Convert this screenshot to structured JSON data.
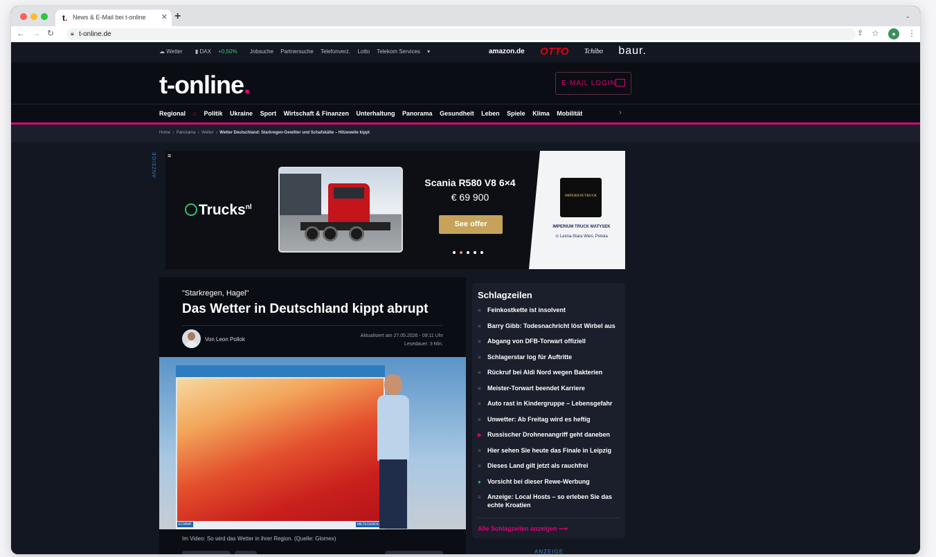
{
  "browser": {
    "tab_title": "News & E-Mail bei t-online",
    "tab_favicon": "t",
    "url": "t-online.de",
    "new_tab_label": "+"
  },
  "topbar": {
    "items": [
      "Wetter",
      "DAX",
      "+0,50%",
      "Jobsuche",
      "Partnersuche",
      "Telefonverz.",
      "Lotto",
      "Telekom Services"
    ],
    "partners": [
      "amazon.de",
      "OTTO",
      "Tchibo",
      "baur."
    ]
  },
  "header": {
    "logo": "t-online",
    "email_login": "E-MAIL LOGIN"
  },
  "nav": {
    "items": [
      "Regional",
      "Politik",
      "Ukraine",
      "Sport",
      "Wirtschaft & Finanzen",
      "Unterhaltung",
      "Panorama",
      "Gesundheit",
      "Leben",
      "Spiele",
      "Klima",
      "Mobilität"
    ]
  },
  "breadcrumb": {
    "items": [
      "Home",
      "Panorama",
      "Wetter"
    ],
    "current": "Wetter Deutschland: Starkregen-Gewitter und Schafskälte – Hitzewelle kippt"
  },
  "ad": {
    "label": "ANZEIGE",
    "brand": "Trucks",
    "brand_sup": "nl",
    "title": "Scania R580 V8 6×4",
    "price": "€ 69 900",
    "cta": "See offer",
    "dealer_logo": "IMPERIUM TRUCK",
    "dealer_name": "IMPERIUM TRUCK MATYSEK",
    "dealer_location": "Leśna-Stara Wieś, Polska",
    "slide_count": 5,
    "active_slide": 2
  },
  "article": {
    "kicker": "\"Starkregen, Hagel\"",
    "headline": "Das Wetter in Deutschland kippt abrupt",
    "author": "Von Leon Pollok",
    "updated": "Aktualisiert am 27.05.2026 - 09:11 Uhr",
    "reading_time": "Lesedauer: 3 Min.",
    "video_caption": "Im Video: So wird das Wetter in ihrer Region. (Quelle: Glomex)",
    "video_badge_left": "ECMWF",
    "video_badge_right": "METEOGROUP"
  },
  "sidebar": {
    "title": "Schlagzeilen",
    "items": [
      {
        "text": "Feinkostkette ist insolvent",
        "icon": "article-icon"
      },
      {
        "text": "Barry Gibb: Todesnachricht löst Wirbel aus",
        "icon": "article-icon"
      },
      {
        "text": "Abgang von DFB-Torwart offiziell",
        "icon": "article-icon"
      },
      {
        "text": "Schlagerstar log für Auftritte",
        "icon": "article-icon"
      },
      {
        "text": "Rückruf bei Aldi Nord wegen Bakterien",
        "icon": "article-icon"
      },
      {
        "text": "Meister-Torwart beendet Karriere",
        "icon": "article-icon"
      },
      {
        "text": "Auto rast in Kindergruppe – Lebensgefahr",
        "icon": "article-icon"
      },
      {
        "text": "Unwetter: Ab Freitag wird es heftig",
        "icon": "article-icon"
      },
      {
        "text": "Russischer Drohnenangriff geht daneben",
        "icon": "play-icon"
      },
      {
        "text": "Hier sehen Sie heute das Finale in Leipzig",
        "icon": "article-icon"
      },
      {
        "text": "Dieses Land gilt jetzt als rauchfrei",
        "icon": "article-icon"
      },
      {
        "text": "Vorsicht bei dieser Rewe-Werbung",
        "icon": "vegan-icon"
      },
      {
        "text": "Anzeige: Local Hosts – so erleben Sie das echte Kroatien",
        "icon": "article-icon"
      }
    ],
    "all_link": "Alle Schlagzeilen anzeigen",
    "ad_label": "ANZEIGE"
  },
  "colors": {
    "brand_magenta": "#e20074",
    "background": "#121722",
    "dax_positive": "#2fd16b"
  }
}
